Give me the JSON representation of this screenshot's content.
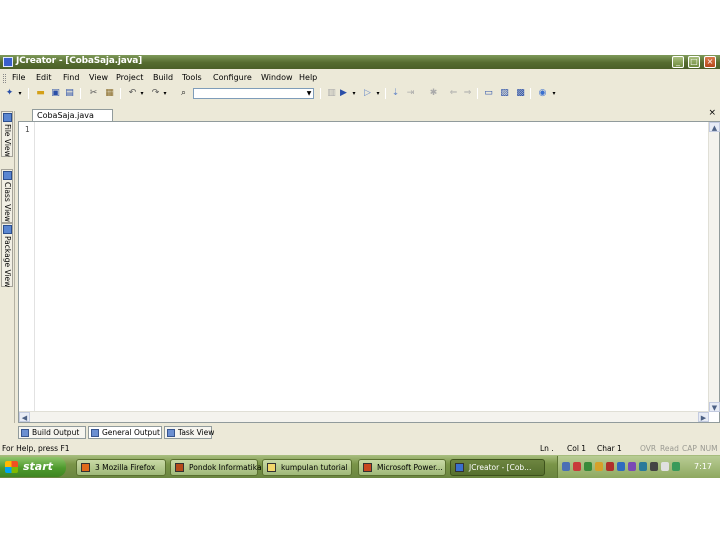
{
  "window": {
    "title": "JCreator - [CobaSaja.java]",
    "minimize_glyph": "_",
    "maximize_glyph": "□",
    "close_glyph": "×"
  },
  "menu": [
    "File",
    "Edit",
    "Find",
    "View",
    "Project",
    "Build",
    "Tools",
    "Configure",
    "Window",
    "Help"
  ],
  "toolbar": {
    "icons": [
      "new-icon",
      "open-icon",
      "save-icon",
      "save-all-icon",
      "cut-icon",
      "paste-icon",
      "undo-icon",
      "redo-icon",
      "find-icon",
      "run-icon",
      "debug-icon",
      "help-icon"
    ],
    "combo_value": ""
  },
  "side_tabs": [
    "File View",
    "Class View",
    "Package View"
  ],
  "editor": {
    "tab_label": "CobaSaja.java",
    "close_glyph": "×",
    "line_numbers": [
      "1"
    ],
    "content": ""
  },
  "output_tabs": [
    "Build Output",
    "General Output",
    "Task View"
  ],
  "status": {
    "help": "For Help, press F1",
    "line": "Ln .",
    "col": "Col 1",
    "char": "Char 1",
    "indicators": [
      "OVR",
      "Read",
      "CAP",
      "NUM"
    ]
  },
  "taskbar": {
    "start_label": "start",
    "tasks": [
      {
        "label": "3 Mozilla Firefox",
        "icon_color": "#e06a1b",
        "active": false
      },
      {
        "label": "Pondok Informatika...",
        "icon_color": "#b54a1a",
        "active": false
      },
      {
        "label": "kumpulan tutorial",
        "icon_color": "#f2d66b",
        "active": false
      },
      {
        "label": "Microsoft Power...",
        "icon_color": "#c8461f",
        "active": false
      },
      {
        "label": "JCreator - [Cob...",
        "icon_color": "#3a6fcf",
        "active": true
      }
    ],
    "clock": "7:17"
  }
}
